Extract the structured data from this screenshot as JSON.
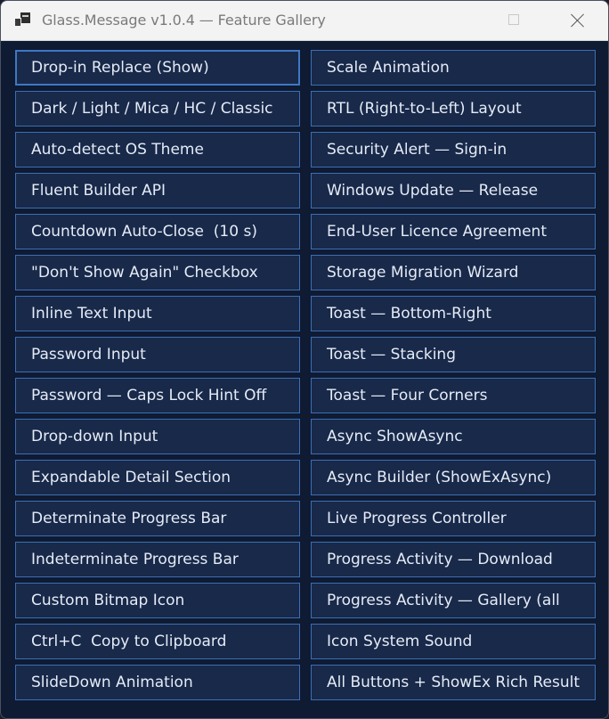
{
  "window": {
    "title": "Glass.Message v1.0.4 — Feature Gallery",
    "icons": {
      "app": "app-window-icon",
      "minimize": "minimize-icon",
      "maximize": "maximize-icon",
      "close": "close-icon"
    }
  },
  "colors": {
    "background": "#0f1a33",
    "button_fill": "#18294a",
    "button_border": "#3b6fb3",
    "button_text": "#e6ebf5",
    "titlebar": "#f3f3f3"
  },
  "buttons": [
    "Drop-in Replace (Show)",
    "Scale Animation",
    "Dark / Light / Mica / HC / Classic",
    "RTL (Right-to-Left) Layout",
    "Auto-detect OS Theme",
    "Security Alert — Sign-in",
    "Fluent Builder API",
    "Windows Update — Release",
    "Countdown Auto-Close  (10 s)",
    "End-User Licence Agreement",
    "\"Don't Show Again\" Checkbox",
    "Storage Migration Wizard",
    "Inline Text Input",
    "Toast — Bottom-Right",
    "Password Input",
    "Toast — Stacking",
    "Password — Caps Lock Hint Off",
    "Toast — Four Corners",
    "Drop-down Input",
    "Async ShowAsync",
    "Expandable Detail Section",
    "Async Builder (ShowExAsync)",
    "Determinate Progress Bar",
    "Live Progress Controller",
    "Indeterminate Progress Bar",
    "Progress Activity — Download",
    "Custom Bitmap Icon",
    "Progress Activity — Gallery (all",
    "Ctrl+C  Copy to Clipboard",
    "Icon System Sound",
    "SlideDown Animation",
    "All Buttons + ShowEx Rich Result"
  ]
}
